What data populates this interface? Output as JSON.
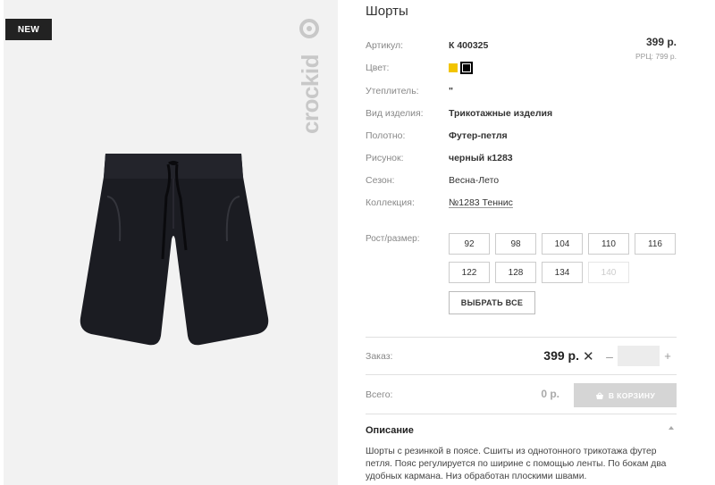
{
  "product": {
    "badge": "NEW",
    "brand": "crockid",
    "title": "Шорты"
  },
  "specs": [
    {
      "label": "Артикул:",
      "value": "К 400325"
    },
    {
      "label": "Цвет:",
      "value": ""
    },
    {
      "label": "Утеплитель:",
      "value": "\""
    },
    {
      "label": "Вид изделия:",
      "value": "Трикотажные изделия"
    },
    {
      "label": "Полотно:",
      "value": "Футер-петля"
    },
    {
      "label": "Рисунок:",
      "value": "черный к1283"
    },
    {
      "label": "Сезон:",
      "value": "Весна-Лето"
    },
    {
      "label": "Коллекция:",
      "value": "№1283 Теннис"
    }
  ],
  "colors": {
    "swatches": [
      "#f2c400",
      "#000000"
    ],
    "selected": "#000000"
  },
  "price": {
    "main": "399 р.",
    "rrc": "РРЦ: 799 р."
  },
  "sizes": {
    "label": "Рост/размер:",
    "options": [
      {
        "label": "92",
        "available": true
      },
      {
        "label": "98",
        "available": true
      },
      {
        "label": "104",
        "available": true
      },
      {
        "label": "110",
        "available": true
      },
      {
        "label": "116",
        "available": true
      },
      {
        "label": "122",
        "available": true
      },
      {
        "label": "128",
        "available": true
      },
      {
        "label": "134",
        "available": true
      },
      {
        "label": "140",
        "available": false
      }
    ],
    "select_all": "ВЫБРАТЬ ВСЕ"
  },
  "order": {
    "label": "Заказ:",
    "price": "399 р.",
    "times": "✕",
    "minus": "–",
    "plus": "+",
    "quantity": ""
  },
  "total": {
    "label": "Всего:",
    "value": "0 р.",
    "cart_button": "В КОРЗИНУ"
  },
  "description": {
    "heading": "Описание",
    "text": "Шорты с резинкой в поясе. Сшиты из однотонного трикотажа футер петля. Пояс регулируется по ширине с помощью ленты. По бокам два удобных кармана. Низ обработан плоскими швами."
  }
}
